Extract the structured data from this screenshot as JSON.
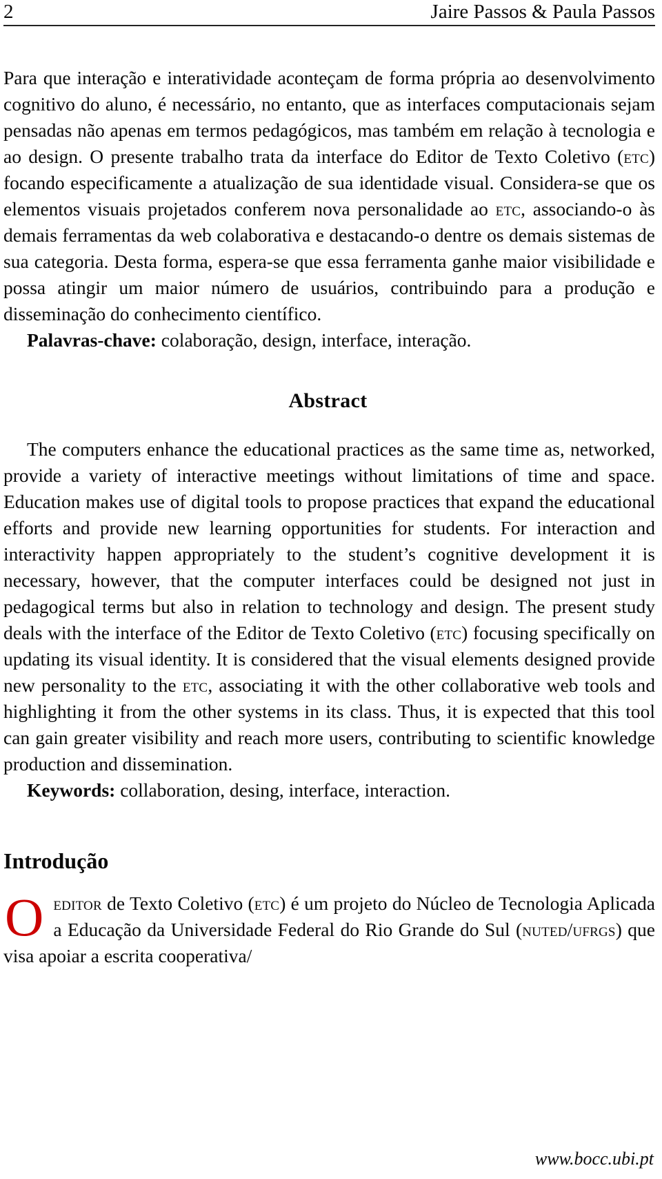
{
  "header": {
    "page_number": "2",
    "authors": "Jaire Passos & Paula Passos"
  },
  "abstract_pt": {
    "paragraph_part1": "Para que interação e interatividade aconteçam de forma própria ao desenvolvimento cognitivo do aluno, é necessário, no entanto, que as interfaces computacionais sejam pensadas não apenas em termos pedagógicos, mas também em relação à tecnologia e ao design. O presente trabalho trata da interface do Editor de Texto Coletivo (",
    "acronym1": "etc",
    "paragraph_part2": ") focando especificamente a atualização de sua identidade visual. Considera-se que os elementos visuais projetados conferem nova personalidade ao ",
    "acronym2": "etc",
    "paragraph_part3": ", associando-o às demais ferramentas da web colaborativa e destacando-o dentre os demais sistemas de sua categoria. Desta forma, espera-se que essa ferramenta ganhe maior visibilidade e possa atingir um maior número de usuários, contribuindo para a produção e disseminação do conhecimento científico.",
    "keywords_label": "Palavras-chave:",
    "keywords_value": "colaboração, design, interface, interação."
  },
  "abstract_en": {
    "heading": "Abstract",
    "paragraph_part1": "The computers enhance the educational practices as the same time as, networked, provide a variety of interactive meetings without limitations of time and space. Education makes use of digital tools to propose practices that expand the educational efforts and provide new learning opportunities for students. For interaction and interactivity happen appropriately to the student’s cognitive development it is necessary, however, that the computer interfaces could be designed not just in pedagogical terms but also in relation to technology and design. The present study deals with the interface of the Editor de Texto Coletivo (",
    "acronym1": "etc",
    "paragraph_part2": ") focusing specifically on updating its visual identity. It is considered that the visual elements designed provide new personality to the ",
    "acronym2": "etc",
    "paragraph_part3": ", associating it with the other collaborative web tools and highlighting it from the other systems in its class. Thus, it is expected that this tool can gain greater visibility and reach more users, contributing to scientific knowledge production and dissemination.",
    "keywords_label": "Keywords:",
    "keywords_value": "collaboration, desing, interface, interaction."
  },
  "introduction": {
    "heading": "Introdução",
    "dropcap": "O",
    "dropcap_color": "#CC0000",
    "lead_smallcaps": "editor",
    "text_part1": " de Texto Coletivo (",
    "acronym1": "etc",
    "text_part2": ") é um projeto do Núcleo de Tecnologia Aplicada a Educação da Universidade Federal do Rio Grande do Sul (",
    "acronym2": "nuted/ufrgs",
    "text_part3": ") que visa apoiar a escrita cooperativa/"
  },
  "footer": {
    "url": "www.bocc.ubi.pt"
  }
}
